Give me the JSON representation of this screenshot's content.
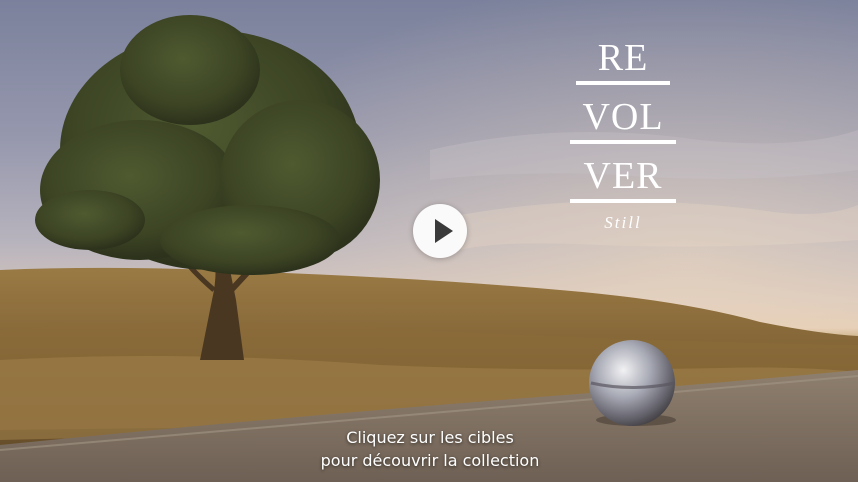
{
  "logo": {
    "line1": "RE",
    "line2": "VOL",
    "line3": "VER",
    "subtitle": "Still"
  },
  "video": {
    "play_icon": "play-icon"
  },
  "caption": {
    "line1": "Cliquez sur les cibles",
    "line2": "pour découvrir la collection"
  },
  "colors": {
    "sky_top": "#7b819c",
    "sky_horizon": "#e0cab4",
    "hill": "#8a6a3c",
    "logo": "#ffffff",
    "play_button_bg": "#ffffff",
    "play_icon": "#3a3a3a"
  }
}
